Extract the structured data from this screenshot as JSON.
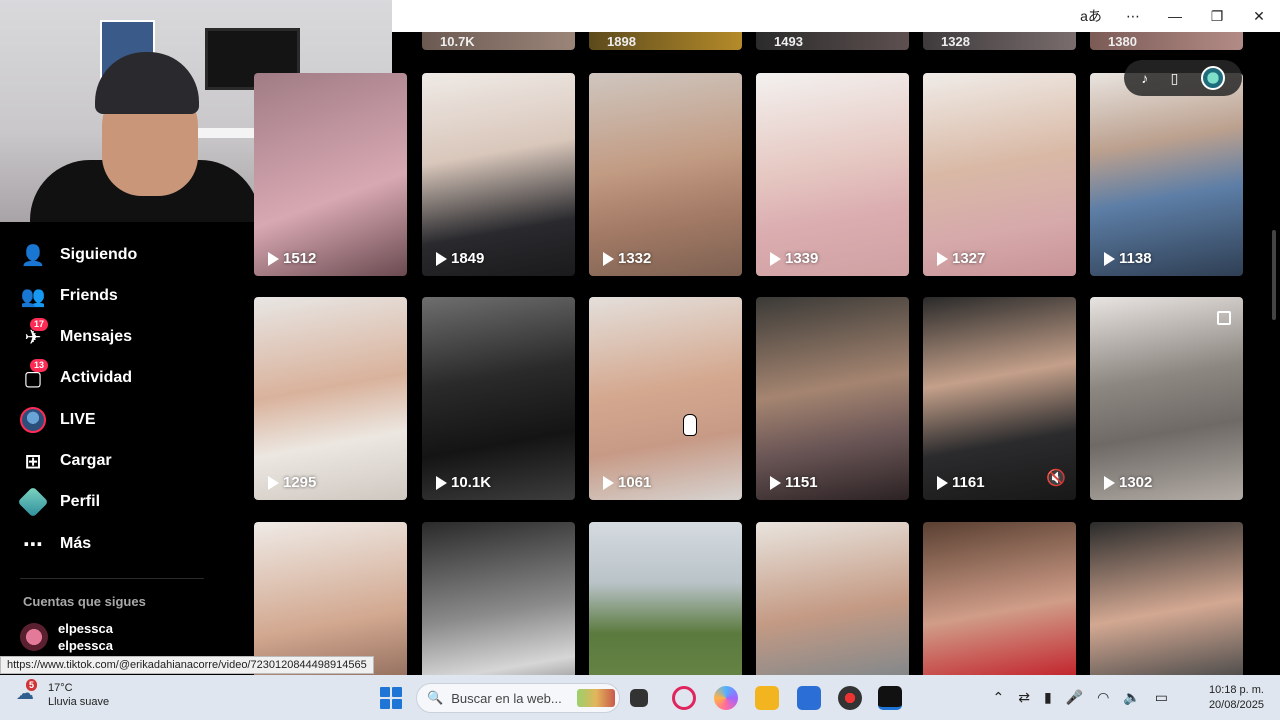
{
  "window": {
    "translate_glyph": "aあ",
    "more_glyph": "⋯",
    "minimize_glyph": "—",
    "maximize_glyph": "❐",
    "close_glyph": "✕"
  },
  "sidebar": {
    "items": [
      {
        "label": "Siguiendo",
        "icon": "following-icon",
        "glyph": "👤"
      },
      {
        "label": "Friends",
        "icon": "friends-icon",
        "glyph": "👥"
      },
      {
        "label": "Mensajes",
        "icon": "messages-icon",
        "glyph": "✈",
        "badge": "17"
      },
      {
        "label": "Actividad",
        "icon": "activity-icon",
        "glyph": "▢",
        "badge": "13"
      },
      {
        "label": "LIVE",
        "icon": "live-avatar"
      },
      {
        "label": "Cargar",
        "icon": "upload-icon",
        "glyph": "⊞"
      },
      {
        "label": "Perfil",
        "icon": "profile-avatar"
      },
      {
        "label": "Más",
        "icon": "more-icon",
        "glyph": "⋯"
      }
    ],
    "section_title": "Cuentas que sigues",
    "following": [
      {
        "username": "elpessca",
        "display_name": "elpessca"
      }
    ]
  },
  "grid": {
    "top_strip": [
      "10.7K",
      "1898",
      "1493",
      "1328",
      "1380"
    ],
    "rows": [
      [
        "1512",
        "1849",
        "1332",
        "1339",
        "1327",
        "1138"
      ],
      [
        "1295",
        "10.1K",
        "1061",
        "1151",
        "1161",
        "1302"
      ],
      [
        "",
        "",
        "",
        "",
        "",
        ""
      ]
    ]
  },
  "tools": {
    "tiktok_glyph": "♪",
    "phone_glyph": "▯"
  },
  "status_url": "https://www.tiktok.com/@erikadahianacorre/video/7230120844498914565",
  "taskbar": {
    "weather_temp": "17°C",
    "weather_desc": "Lluvia suave",
    "weather_badge": "5",
    "search_placeholder": "Buscar en la web...",
    "time": "10:18 p. m.",
    "date": "20/08/2025",
    "accent": "#1f75d6"
  }
}
